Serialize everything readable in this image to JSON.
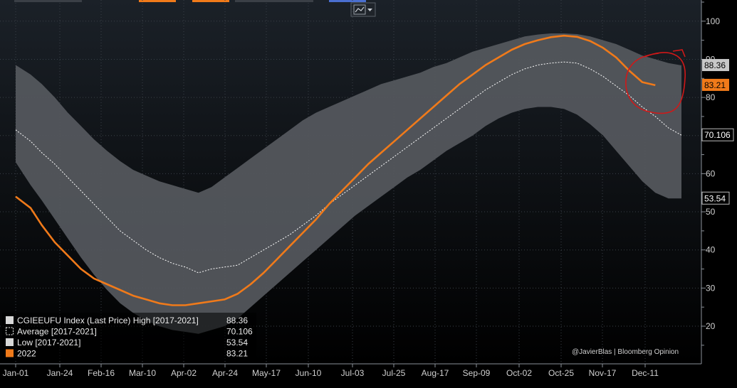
{
  "chart_data": {
    "type": "area",
    "x_labels": [
      "Jan-01",
      "Jan-24",
      "Feb-16",
      "Mar-10",
      "Apr-02",
      "Apr-24",
      "May-17",
      "Jun-10",
      "Jul-03",
      "Jul-25",
      "Aug-17",
      "Sep-09",
      "Oct-02",
      "Oct-25",
      "Nov-17",
      "Dec-11"
    ],
    "y_ticks": [
      20,
      30,
      40,
      50,
      60,
      70,
      80,
      90,
      100
    ],
    "ylim": [
      10,
      105
    ],
    "grid": true,
    "legend_position": "bottom-left",
    "credit": "@JavierBlas | Bloomberg Opinion",
    "colors": {
      "background_top": "#1b2128",
      "background_bottom": "#000000",
      "band": "#56595e",
      "series_2022": "#f07a1a",
      "average": "#ffffff",
      "highlight": "#d01818"
    },
    "series": [
      {
        "name": "CGIEEUFU Index (Last Price) High [2017-2021]",
        "last_value": "88.36",
        "x": [
          0,
          8,
          14,
          21,
          28,
          35,
          42,
          49,
          56,
          63,
          70,
          77,
          84,
          91,
          98,
          105,
          112,
          119,
          126,
          133,
          140,
          147,
          154,
          161,
          168,
          175,
          182,
          189,
          196,
          203,
          210,
          217,
          224,
          231,
          238,
          245,
          252,
          259,
          266,
          273,
          280,
          287,
          294,
          301,
          308,
          315,
          322,
          329,
          336,
          343,
          350,
          357
        ],
        "values": [
          88.5,
          86,
          83.5,
          80,
          76,
          72.5,
          69,
          66,
          63.3,
          61,
          59.5,
          58,
          57,
          56,
          55,
          56.5,
          59,
          61.5,
          64,
          66.5,
          69,
          71.5,
          74,
          76,
          77.5,
          79,
          80.5,
          82,
          83.5,
          84.5,
          85.5,
          86.5,
          88,
          89,
          90.5,
          92,
          93,
          94,
          95,
          96,
          96.5,
          96.8,
          96.8,
          96.6,
          96,
          95,
          94,
          92.5,
          91,
          90,
          89,
          88.4
        ]
      },
      {
        "name": "Average  [2017-2021]",
        "last_value": "70.106",
        "x": [
          0,
          8,
          14,
          21,
          28,
          35,
          42,
          49,
          56,
          63,
          70,
          77,
          84,
          91,
          98,
          105,
          112,
          119,
          126,
          133,
          140,
          147,
          154,
          161,
          168,
          175,
          182,
          189,
          196,
          203,
          210,
          217,
          224,
          231,
          238,
          245,
          252,
          259,
          266,
          273,
          280,
          287,
          294,
          301,
          308,
          315,
          322,
          329,
          336,
          343,
          350,
          357
        ],
        "values": [
          71.5,
          68.5,
          65.5,
          62.5,
          59,
          55.5,
          52,
          48.5,
          45,
          42.5,
          40,
          38,
          36.5,
          35.5,
          34,
          35,
          35.5,
          36,
          38,
          40,
          42,
          44,
          46.5,
          49,
          52,
          54.5,
          57,
          59.5,
          62,
          64.5,
          67,
          69.5,
          72,
          74.5,
          77,
          79.5,
          82,
          84,
          86,
          87.5,
          88.5,
          89,
          89.3,
          89,
          87.5,
          85.5,
          83,
          80.5,
          77.5,
          75,
          72,
          70.1
        ]
      },
      {
        "name": "Low  [2017-2021]",
        "last_value": "53.54",
        "x": [
          0,
          8,
          14,
          21,
          28,
          35,
          42,
          49,
          56,
          63,
          70,
          77,
          84,
          91,
          98,
          105,
          112,
          119,
          126,
          133,
          140,
          147,
          154,
          161,
          168,
          175,
          182,
          189,
          196,
          203,
          210,
          217,
          224,
          231,
          238,
          245,
          252,
          259,
          266,
          273,
          280,
          287,
          294,
          301,
          308,
          315,
          322,
          329,
          336,
          343,
          350,
          357
        ],
        "values": [
          63,
          57,
          53,
          48,
          43,
          38,
          33.5,
          29.5,
          26,
          23.5,
          21.5,
          20,
          19,
          18.5,
          18,
          19,
          20,
          22,
          25,
          28,
          31,
          34,
          37,
          40,
          43,
          46,
          49,
          51.5,
          54,
          56.5,
          59,
          61,
          63.5,
          66,
          68,
          70,
          72.5,
          74.5,
          76,
          77,
          77.5,
          77.5,
          77,
          75.5,
          73,
          70,
          66,
          62,
          58,
          55,
          53.5,
          53.5
        ]
      },
      {
        "name": "2022",
        "last_value": "83.21",
        "x": [
          0,
          8,
          14,
          21,
          28,
          35,
          42,
          49,
          56,
          63,
          70,
          77,
          84,
          91,
          98,
          105,
          112,
          119,
          126,
          133,
          140,
          147,
          154,
          161,
          168,
          175,
          182,
          189,
          196,
          203,
          210,
          217,
          224,
          231,
          238,
          245,
          252,
          259,
          266,
          273,
          280,
          287,
          294,
          301,
          308,
          315,
          322,
          329,
          336,
          343
        ],
        "values": [
          54,
          51,
          46.5,
          42,
          38.5,
          35,
          32.5,
          31,
          29.5,
          28,
          27,
          26,
          25.5,
          25.5,
          26,
          26.5,
          27,
          28.5,
          31,
          34,
          37.5,
          41,
          44.5,
          48,
          52,
          55.5,
          59,
          62.5,
          65.5,
          68.5,
          71.5,
          74.5,
          77.5,
          80.5,
          83.5,
          86,
          88.5,
          90.5,
          92.5,
          94,
          95,
          95.8,
          96.2,
          95.9,
          94.8,
          93,
          90.5,
          87,
          84,
          83.2
        ]
      }
    ]
  }
}
